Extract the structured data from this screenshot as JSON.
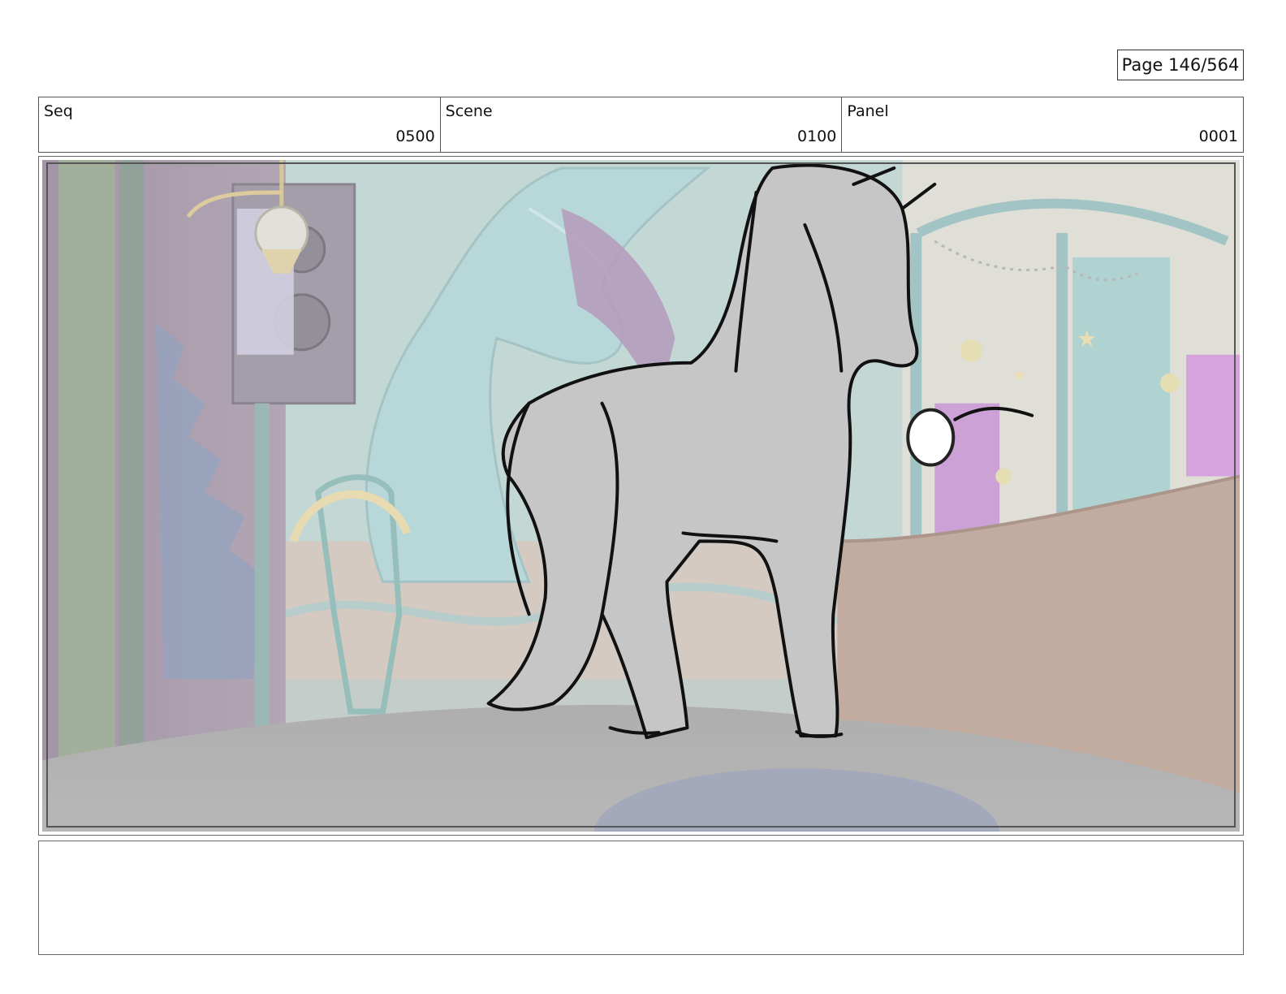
{
  "page": {
    "page_number": "Page 146/564"
  },
  "header": {
    "seq_label": "Seq",
    "seq_value": "0500",
    "scene_label": "Scene",
    "scene_value": "0100",
    "panel_label": "Panel",
    "panel_value": "0001"
  },
  "panel": {
    "icon": "storyboard-panel-image"
  },
  "notes": {
    "text": ""
  }
}
